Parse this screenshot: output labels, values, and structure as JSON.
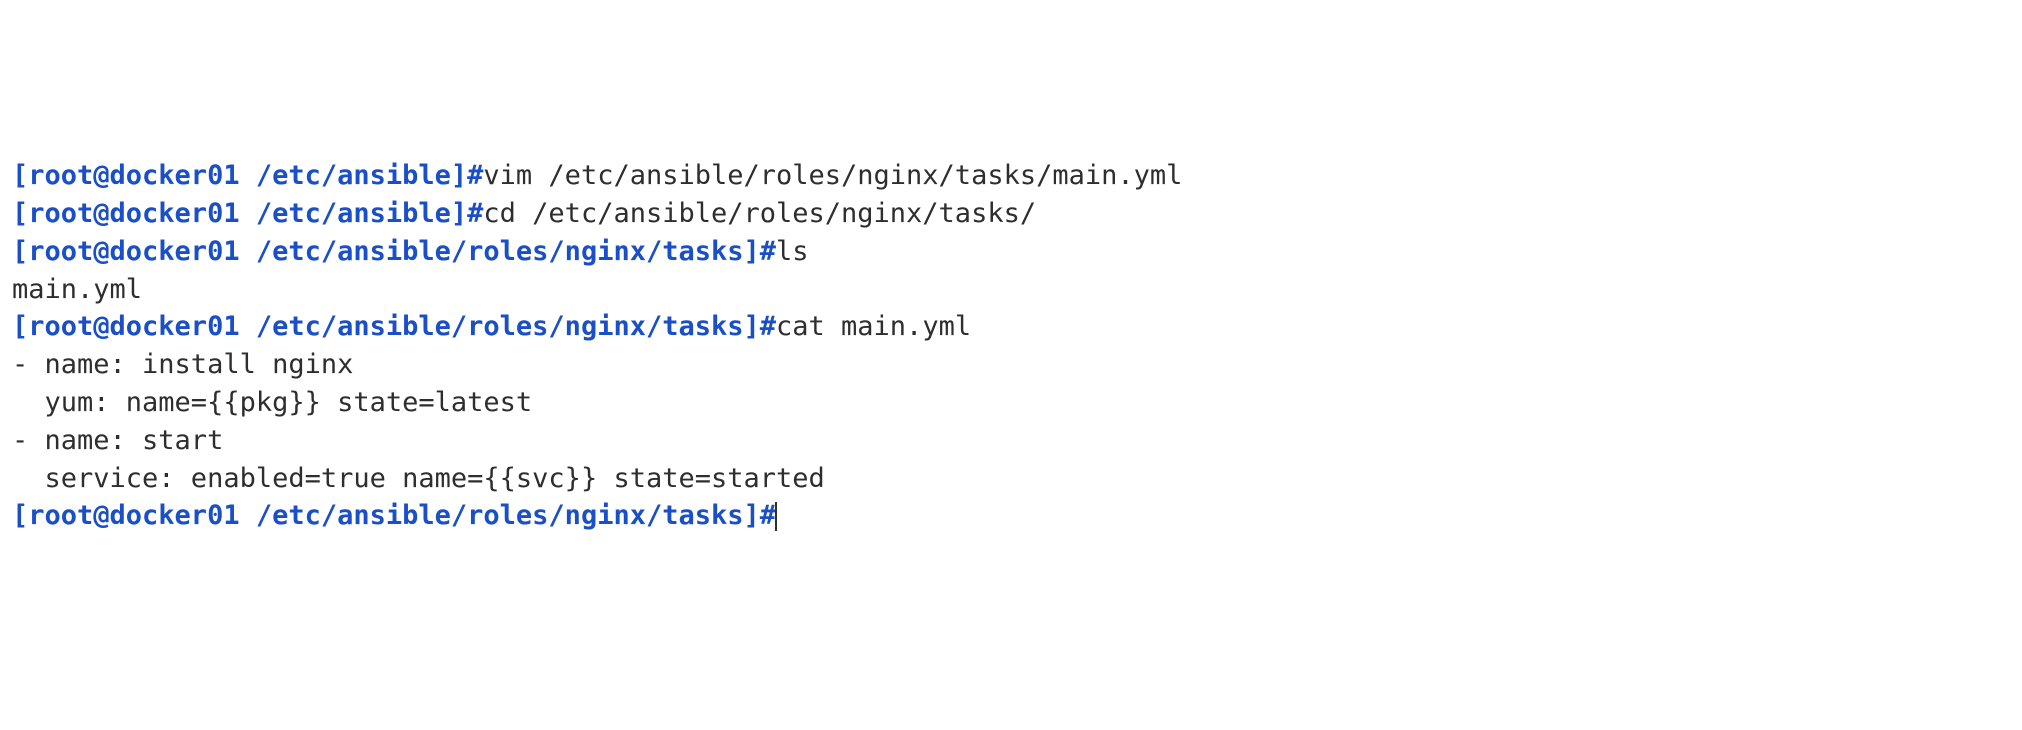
{
  "lines": {
    "l1": {
      "prompt": "[root@docker01 /etc/ansible]#",
      "cmd": "vim /etc/ansible/roles/nginx/tasks/main.yml"
    },
    "l2": {
      "prompt": "[root@docker01 /etc/ansible]#",
      "cmd": "cd /etc/ansible/roles/nginx/tasks/"
    },
    "l3": {
      "prompt": "[root@docker01 /etc/ansible/roles/nginx/tasks]#",
      "cmd": "ls"
    },
    "l4": {
      "out": "main.yml"
    },
    "l5": {
      "prompt": "[root@docker01 /etc/ansible/roles/nginx/tasks]#",
      "cmd": "cat main.yml"
    },
    "l6": {
      "out": "- name: install nginx"
    },
    "l7": {
      "out": "  yum: name={{pkg}} state=latest"
    },
    "l8": {
      "out": "- name: start"
    },
    "l9": {
      "out": "  service: enabled=true name={{svc}} state=started"
    },
    "l10": {
      "prompt": "[root@docker01 /etc/ansible/roles/nginx/tasks]#"
    }
  }
}
